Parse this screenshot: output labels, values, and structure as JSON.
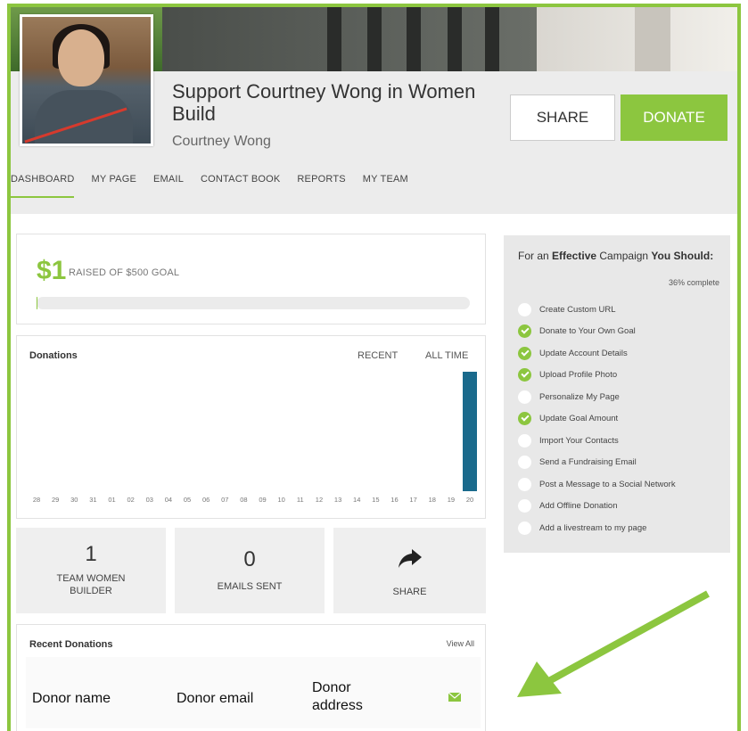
{
  "campaign": {
    "title": "Support Courtney Wong in Women Build",
    "owner": "Courtney Wong",
    "share_label": "SHARE",
    "donate_label": "DONATE"
  },
  "nav": [
    "DASHBOARD",
    "MY PAGE",
    "EMAIL",
    "CONTACT BOOK",
    "REPORTS",
    "MY TEAM"
  ],
  "raised": {
    "amount": "$1",
    "goal_text": "RAISED OF $500 GOAL",
    "progress_fraction": 0.002
  },
  "donations": {
    "title": "Donations",
    "toggle_recent": "RECENT",
    "toggle_all": "ALL TIME"
  },
  "chart_data": {
    "type": "bar",
    "categories": [
      "28",
      "29",
      "30",
      "31",
      "01",
      "02",
      "03",
      "04",
      "05",
      "06",
      "07",
      "08",
      "09",
      "10",
      "11",
      "12",
      "13",
      "14",
      "15",
      "16",
      "17",
      "18",
      "19",
      "20"
    ],
    "values": [
      0,
      0,
      0,
      0,
      0,
      0,
      0,
      0,
      0,
      0,
      0,
      0,
      0,
      0,
      0,
      0,
      0,
      0,
      0,
      0,
      0,
      0,
      0,
      1
    ],
    "color": "#1a6a8c",
    "title": "Donations",
    "xlabel": "",
    "ylabel": "",
    "ylim": [
      0,
      1
    ]
  },
  "stats": [
    {
      "number": "1",
      "label": "TEAM WOMEN BUILDER"
    },
    {
      "number": "0",
      "label": "EMAILS SENT"
    },
    {
      "number": "",
      "label": "SHARE",
      "icon": "share-arrow-icon"
    }
  ],
  "recent": {
    "title": "Recent Donations",
    "view_all": "View All"
  },
  "annotations": {
    "donor_name": "Donor name",
    "donor_email": "Donor email",
    "donor_address_1": "Donor",
    "donor_address_2": "address"
  },
  "checklist": {
    "heading_1": "For an ",
    "heading_bold_1": "Effective",
    "heading_2": " Campaign ",
    "heading_bold_2": "You Should:",
    "percent": "36% complete",
    "items": [
      {
        "label": "Create Custom URL",
        "done": false
      },
      {
        "label": "Donate to Your Own Goal",
        "done": true
      },
      {
        "label": "Update Account Details",
        "done": true
      },
      {
        "label": "Upload Profile Photo",
        "done": true
      },
      {
        "label": "Personalize My Page",
        "done": false
      },
      {
        "label": "Update Goal Amount",
        "done": true
      },
      {
        "label": "Import Your Contacts",
        "done": false
      },
      {
        "label": "Send a Fundraising Email",
        "done": false
      },
      {
        "label": "Post a Message to a Social Network",
        "done": false
      },
      {
        "label": "Add Offline Donation",
        "done": false
      },
      {
        "label": "Add a livestream to my page",
        "done": false
      }
    ]
  },
  "colors": {
    "accent": "#8cc63f",
    "bar": "#1a6a8c"
  }
}
